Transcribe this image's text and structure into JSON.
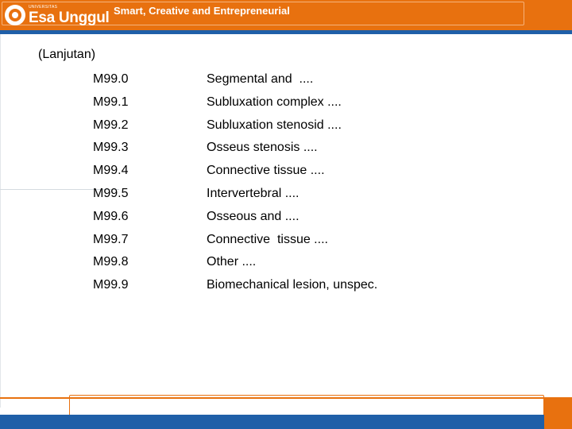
{
  "header": {
    "logo_small": "UNIVERSITAS",
    "logo_text": "Esa Unggul",
    "tagline": "Smart, Creative and Entrepreneurial"
  },
  "slide": {
    "subtitle": "(Lanjutan)",
    "rows": [
      {
        "code": "M99.0",
        "desc": "Segmental and  ...."
      },
      {
        "code": "M99.1",
        "desc": "Subluxation complex ...."
      },
      {
        "code": "M99.2",
        "desc": "Subluxation stenosid ...."
      },
      {
        "code": "M99.3",
        "desc": "Osseus stenosis ...."
      },
      {
        "code": "M99.4",
        "desc": "Connective tissue ...."
      },
      {
        "code": "M99.5",
        "desc": "Intervertebral ...."
      },
      {
        "code": "M99.6",
        "desc": "Osseous and ...."
      },
      {
        "code": "M99.7",
        "desc": "Connective  tissue ...."
      },
      {
        "code": "M99.8",
        "desc": "Other ...."
      },
      {
        "code": "M99.9",
        "desc": "Biomechanical lesion, unspec."
      }
    ]
  },
  "colors": {
    "brand_orange": "#e8710f",
    "brand_blue": "#1f5fa8"
  }
}
